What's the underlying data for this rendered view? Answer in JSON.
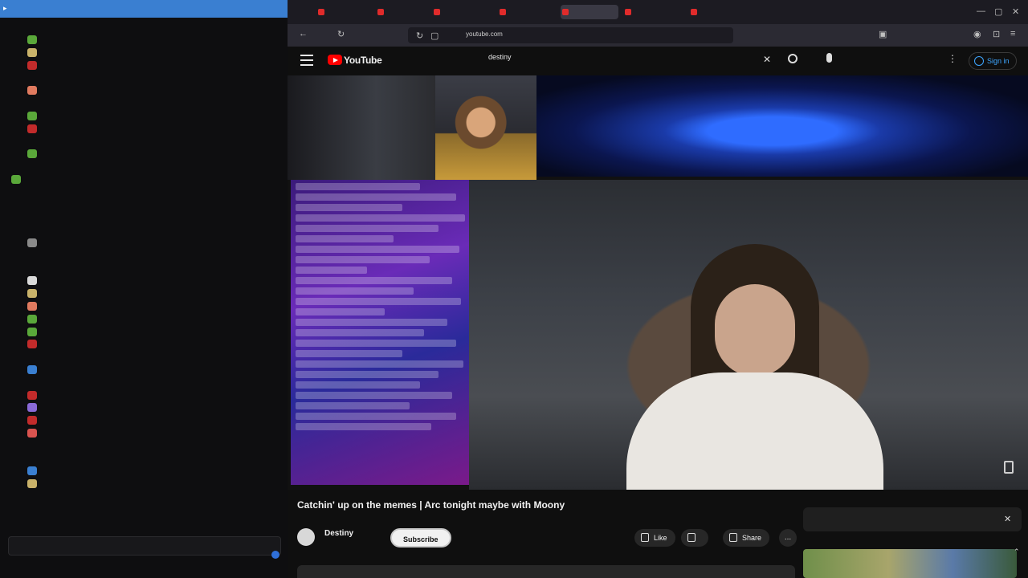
{
  "chat": {
    "lines": [
      {
        "user": "",
        "msg": "",
        "user_color": "#b5b5b5",
        "emote": "",
        "indent": true
      },
      {
        "user": "",
        "msg": "",
        "user_color": "#b5b5b5",
        "emote": "#5aa83a",
        "indent": false
      },
      {
        "user": "",
        "msg": "",
        "user_color": "#2ec27e",
        "emote": "#c9b26a",
        "indent": false
      },
      {
        "user": "",
        "msg": "",
        "user_color": "#cfcfcf",
        "emote": "#c22b2b",
        "indent": false
      },
      {
        "user": "",
        "msg": "",
        "user_color": "#3a7fd1",
        "emote": "",
        "indent": false
      },
      {
        "user": "",
        "msg": "",
        "user_color": "#b5b5b5",
        "emote": "#e07a5f",
        "indent": false
      },
      {
        "user": "",
        "msg": "",
        "user_color": "#b5b5b5",
        "emote": "",
        "indent": false
      },
      {
        "user": "",
        "msg": "",
        "user_color": "#b5b5b5",
        "emote": "#5aa83a",
        "indent": false
      },
      {
        "user": "",
        "msg": "",
        "user_color": "#2ec27e",
        "emote": "#c22b2b",
        "indent": false
      },
      {
        "user": "",
        "msg": "",
        "user_color": "#b5b5b5",
        "emote": "",
        "indent": false
      },
      {
        "user": "",
        "msg": "",
        "user_color": "#b5b5b5",
        "emote": "#5aa83a",
        "indent": false
      },
      {
        "user": "",
        "msg": "",
        "user_color": "#b5b5b5",
        "emote": "",
        "indent": false
      },
      {
        "user": "",
        "msg": "",
        "user_color": "#3a7fd1",
        "emote": "#5aa83a",
        "indent": true
      },
      {
        "user": "",
        "msg": "",
        "user_color": "#b5b5b5",
        "emote": "",
        "indent": false
      },
      {
        "user": "",
        "msg": "",
        "user_color": "#3a7fd1",
        "emote": "",
        "indent": false
      },
      {
        "user": "",
        "msg": "",
        "user_color": "#b5b5b5",
        "emote": "",
        "indent": false
      },
      {
        "user": "",
        "msg": "",
        "user_color": "#b5b5b5",
        "emote": "",
        "indent": false
      },
      {
        "user": "",
        "msg": "",
        "user_color": "#b5b5b5",
        "emote": "#8a8a8a",
        "indent": false
      },
      {
        "user": "",
        "msg": "",
        "user_color": "#3a7fd1",
        "emote": "",
        "indent": false
      },
      {
        "user": "",
        "msg": "",
        "user_color": "#2ec27e",
        "emote": "",
        "indent": false
      },
      {
        "user": "",
        "msg": "",
        "user_color": "#b5b5b5",
        "emote": "#d9d9d9",
        "indent": false
      },
      {
        "user": "",
        "msg": "",
        "user_color": "#b5b5b5",
        "emote": "#c9b26a",
        "indent": false
      },
      {
        "user": "",
        "msg": "",
        "user_color": "#b5b5b5",
        "emote": "#e07a5f",
        "indent": false
      },
      {
        "user": "",
        "msg": "",
        "user_color": "#b5b5b5",
        "emote": "#5aa83a",
        "indent": false
      },
      {
        "user": "",
        "msg": "",
        "user_color": "#3a7fd1",
        "emote": "#5aa83a",
        "indent": false
      },
      {
        "user": "",
        "msg": "",
        "user_color": "#c22b2b",
        "emote": "#c22b2b",
        "indent": false
      },
      {
        "user": "",
        "msg": "",
        "user_color": "#b5b5b5",
        "emote": "",
        "indent": false
      },
      {
        "user": "",
        "msg": "",
        "user_color": "#b5b5b5",
        "emote": "#3a7fd1",
        "indent": false
      },
      {
        "user": "",
        "msg": "",
        "user_color": "#b5b5b5",
        "emote": "",
        "indent": false
      },
      {
        "user": "",
        "msg": "",
        "user_color": "#b5b5b5",
        "emote": "#c22b2b",
        "indent": false
      },
      {
        "user": "",
        "msg": "",
        "user_color": "#b5b5b5",
        "emote": "#8a6ad8",
        "indent": false
      },
      {
        "user": "",
        "msg": "",
        "user_color": "#b5b5b5",
        "emote": "#c22b2b",
        "indent": false
      },
      {
        "user": "",
        "msg": "",
        "user_color": "#3a7fd1",
        "emote": "#d9534f",
        "indent": false
      },
      {
        "user": "",
        "msg": "",
        "user_color": "#b5b5b5",
        "emote": "",
        "indent": false
      },
      {
        "user": "",
        "msg": "",
        "user_color": "#b5b5b5",
        "emote": "",
        "indent": false
      },
      {
        "user": "",
        "msg": "",
        "user_color": "#2ec27e",
        "emote": "#3a7fd1",
        "indent": false
      },
      {
        "user": "",
        "msg": "",
        "user_color": "#b5b5b5",
        "emote": "#c9b26a",
        "indent": false
      },
      {
        "user": "",
        "msg": "",
        "user_color": "#3a7fd1",
        "emote": "",
        "indent": false
      }
    ],
    "accent": "#3a7fd1"
  },
  "browser": {
    "url": "youtube.com",
    "tabs": [
      {
        "label": "",
        "active": false
      },
      {
        "label": "",
        "active": false
      },
      {
        "label": "",
        "active": false
      },
      {
        "label": "",
        "active": false
      },
      {
        "label": "",
        "active": true
      },
      {
        "label": "",
        "active": false
      },
      {
        "label": "",
        "active": false
      }
    ]
  },
  "youtube": {
    "logo_text": "YouTube",
    "search_query": "destiny",
    "sign_in": "Sign in",
    "video_title": "Catchin' up on the memes | Arc tonight maybe with Moony",
    "channel_name": "Destiny",
    "subscribe_label": "Subscribe",
    "like_label": "Like",
    "dislike_label": "",
    "share_label": "Share",
    "more_label": "...",
    "description_line": "",
    "rec_text": "",
    "brand_red": "#ff0000",
    "link_blue": "#3ea6ff"
  }
}
